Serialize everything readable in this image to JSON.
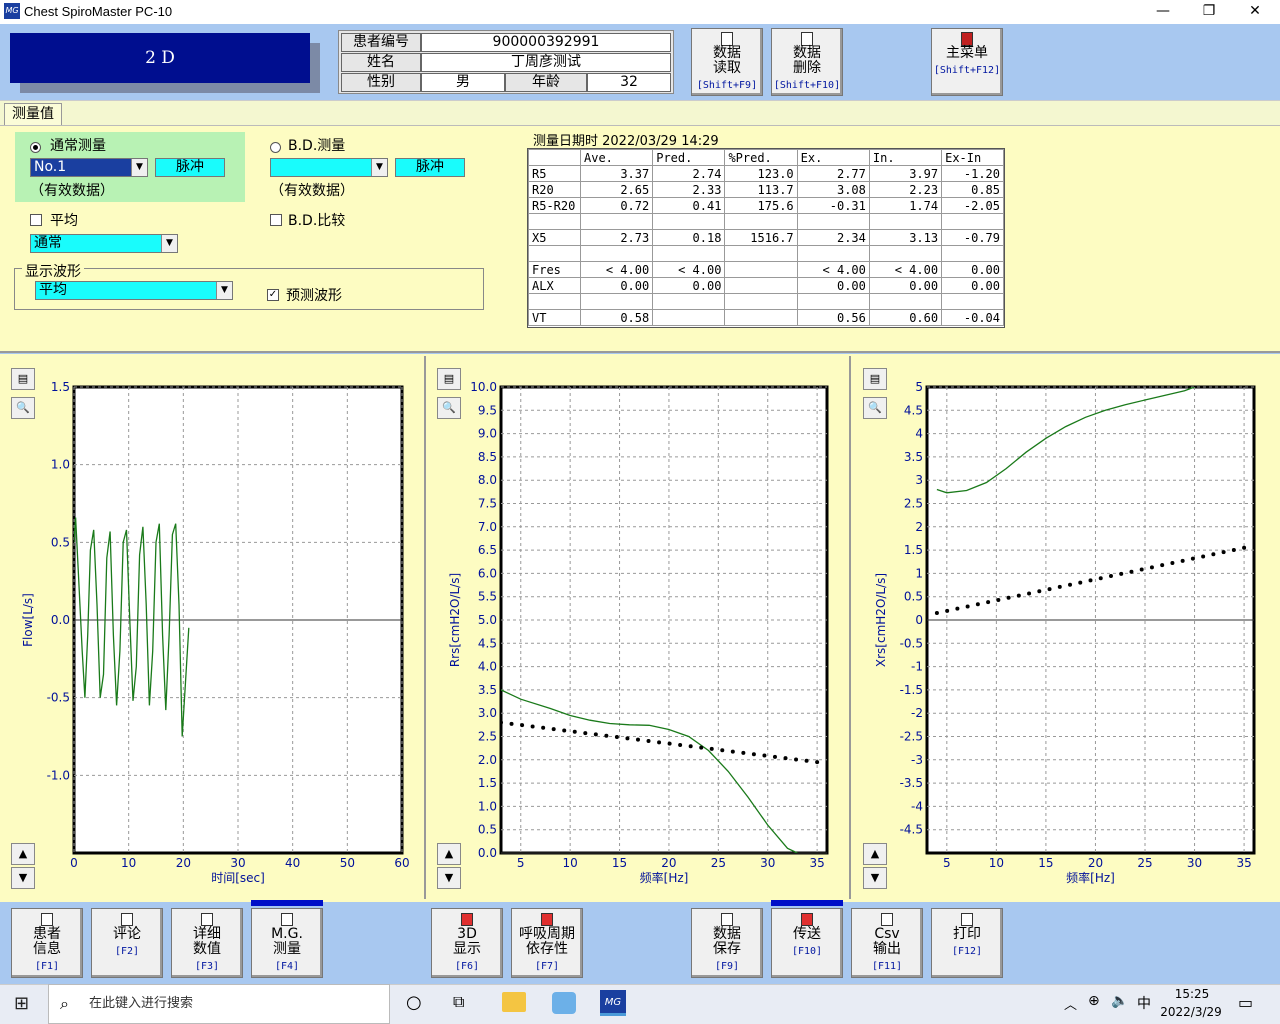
{
  "window": {
    "title": "Chest SpiroMaster PC-10",
    "app_icon": "MG"
  },
  "mode_label": "2 D",
  "patient": {
    "id_label": "患者编号",
    "id_value": "900000392991",
    "name_label": "姓名",
    "name_value": "丁周彦测试",
    "sex_label": "性别",
    "sex_value": "男",
    "age_label": "年龄",
    "age_value": "32"
  },
  "toolbar": {
    "read": {
      "label1": "数据",
      "label2": "读取",
      "key": "[Shift+F9]"
    },
    "delete": {
      "label1": "数据",
      "label2": "删除",
      "key": "[Shift+F10]"
    },
    "main": {
      "label": "主菜单",
      "key": "[Shift+F12]"
    }
  },
  "tab": "测量值",
  "controls": {
    "normal_label": "通常测量",
    "normal_select": "No.1",
    "pulse": "脉冲",
    "valid_data": "（有效数据）",
    "bd_label": "B.D.测量",
    "bd_select": "",
    "bd_pulse": "脉冲",
    "bd_valid": "（有效数据）",
    "avg_label": "平均",
    "bd_compare": "B.D.比较",
    "mode_select": "通常",
    "wave_group": "显示波形",
    "wave_select": "平均",
    "pred_wave": "预测波形"
  },
  "table": {
    "date_label": "测量日期时 2022/03/29 14:29",
    "headers": [
      "",
      "Ave.",
      "Pred.",
      "%Pred.",
      "Ex.",
      "In.",
      "Ex-In"
    ],
    "rows": [
      [
        "R5",
        "3.37",
        "2.74",
        "123.0",
        "2.77",
        "3.97",
        "-1.20"
      ],
      [
        "R20",
        "2.65",
        "2.33",
        "113.7",
        "3.08",
        "2.23",
        "0.85"
      ],
      [
        "R5-R20",
        "0.72",
        "0.41",
        "175.6",
        "-0.31",
        "1.74",
        "-2.05"
      ],
      [
        "",
        "",
        "",
        "",
        "",
        "",
        ""
      ],
      [
        "X5",
        "2.73",
        "0.18",
        "1516.7",
        "2.34",
        "3.13",
        "-0.79"
      ],
      [
        "",
        "",
        "",
        "",
        "",
        "",
        ""
      ],
      [
        "Fres",
        "< 4.00",
        "< 4.00",
        "",
        "< 4.00",
        "< 4.00",
        "0.00"
      ],
      [
        "ALX",
        "0.00",
        "0.00",
        "",
        "0.00",
        "0.00",
        "0.00"
      ],
      [
        "",
        "",
        "",
        "",
        "",
        "",
        ""
      ],
      [
        "VT",
        "0.58",
        "",
        "",
        "0.56",
        "0.60",
        "-0.04"
      ]
    ]
  },
  "chart_data": [
    {
      "type": "line",
      "ylabel": "Flow[L/s]",
      "xlabel": "时间[sec]",
      "xlim": [
        0,
        60
      ],
      "ylim": [
        -1.5,
        1.5
      ],
      "xticks": [
        "0",
        "10",
        "20",
        "30",
        "40",
        "50",
        "60"
      ],
      "yticks": [
        "1.5",
        "1.0",
        "0.5",
        "0.0",
        "-0.5",
        "-1.0"
      ],
      "series": [
        {
          "x": [
            0.0,
            0.3,
            0.8,
            1.5,
            2.0,
            2.5,
            3.0,
            3.6,
            4.2,
            4.8,
            5.4,
            6.0,
            6.6,
            7.2,
            7.8,
            8.4,
            9.0,
            9.6,
            10.2,
            10.8,
            11.4,
            12.0,
            12.6,
            13.2,
            13.8,
            14.4,
            15.0,
            15.6,
            16.2,
            16.8,
            17.4,
            18.0,
            18.6,
            19.2,
            19.8,
            20.4,
            21.0
          ],
          "y": [
            0.5,
            0.66,
            0.3,
            -0.2,
            -0.5,
            -0.1,
            0.45,
            0.58,
            0.1,
            -0.5,
            -0.35,
            0.4,
            0.57,
            -0.1,
            -0.55,
            -0.2,
            0.5,
            0.58,
            0.0,
            -0.52,
            -0.3,
            0.42,
            0.6,
            0.1,
            -0.55,
            -0.2,
            0.5,
            0.62,
            -0.1,
            -0.58,
            -0.1,
            0.55,
            0.62,
            0.1,
            -0.75,
            -0.4,
            -0.05
          ]
        }
      ]
    },
    {
      "type": "line",
      "ylabel": "Rrs[cmH2O/L/s]",
      "xlabel": "频率[Hz]",
      "xlim": [
        3,
        36
      ],
      "ylim": [
        0,
        10
      ],
      "xticks": [
        "5",
        "10",
        "15",
        "20",
        "25",
        "30",
        "35"
      ],
      "yticks": [
        "10.0",
        "9.5",
        "9.0",
        "8.5",
        "8.0",
        "7.5",
        "7.0",
        "6.5",
        "6.0",
        "5.5",
        "5.0",
        "4.5",
        "4.0",
        "3.5",
        "3.0",
        "2.5",
        "2.0",
        "1.5",
        "1.0",
        "0.5",
        "0.0"
      ],
      "series": [
        {
          "x": [
            3,
            5,
            8,
            10,
            12,
            14,
            16,
            18,
            20,
            22,
            24,
            26,
            28,
            30,
            32,
            33
          ],
          "y": [
            3.5,
            3.3,
            3.1,
            2.95,
            2.85,
            2.78,
            2.75,
            2.74,
            2.65,
            2.5,
            2.2,
            1.75,
            1.2,
            0.6,
            0.1,
            0.0
          ]
        },
        {
          "x": [
            3,
            35
          ],
          "y": [
            2.8,
            1.95
          ],
          "style": "dotted"
        }
      ]
    },
    {
      "type": "line",
      "ylabel": "Xrs[cmH2O/L/s]",
      "xlabel": "频率[Hz]",
      "xlim": [
        3,
        36
      ],
      "ylim": [
        -5,
        5
      ],
      "xticks": [
        "5",
        "10",
        "15",
        "20",
        "25",
        "30",
        "35"
      ],
      "yticks": [
        "5",
        "4.5",
        "4",
        "3.5",
        "3",
        "2.5",
        "2",
        "1.5",
        "1",
        "0.5",
        "0",
        "-0.5",
        "-1",
        "-1.5",
        "-2",
        "-2.5",
        "-3",
        "-3.5",
        "-4",
        "-4.5"
      ],
      "series": [
        {
          "x": [
            4,
            5,
            7,
            9,
            11,
            13,
            15,
            17,
            19,
            21,
            23,
            25,
            27,
            29,
            30
          ],
          "y": [
            2.8,
            2.73,
            2.78,
            2.95,
            3.25,
            3.6,
            3.9,
            4.15,
            4.35,
            4.5,
            4.62,
            4.72,
            4.82,
            4.92,
            5.0
          ]
        },
        {
          "x": [
            4,
            35
          ],
          "y": [
            0.15,
            1.55
          ],
          "style": "dotted"
        }
      ]
    }
  ],
  "bottom": {
    "b1": {
      "l1": "患者",
      "l2": "信息",
      "k": "[F1]"
    },
    "b2": {
      "l1": "评论",
      "l2": "",
      "k": "[F2]"
    },
    "b3": {
      "l1": "详细",
      "l2": "数值",
      "k": "[F3]"
    },
    "b4": {
      "l1": "M.G.",
      "l2": "测量",
      "k": "[F4]"
    },
    "b6": {
      "l1": "3D",
      "l2": "显示",
      "k": "[F6]"
    },
    "b7": {
      "l1": "呼吸周期",
      "l2": "依存性",
      "k": "[F7]"
    },
    "b9": {
      "l1": "数据",
      "l2": "保存",
      "k": "[F9]"
    },
    "b10": {
      "l1": "传送",
      "l2": "",
      "k": "[F10]"
    },
    "b11": {
      "l1": "Csv",
      "l2": "输出",
      "k": "[F11]"
    },
    "b12": {
      "l1": "打印",
      "l2": "",
      "k": "[F12]"
    }
  },
  "taskbar": {
    "search": "在此键入进行搜索",
    "time": "15:25",
    "date": "2022/3/29",
    "ime": "中"
  },
  "colors": {
    "accent": "#000e8f",
    "panel": "#fdfcc2",
    "green": "#1a7a1a",
    "cyan": "#19fcfc"
  }
}
